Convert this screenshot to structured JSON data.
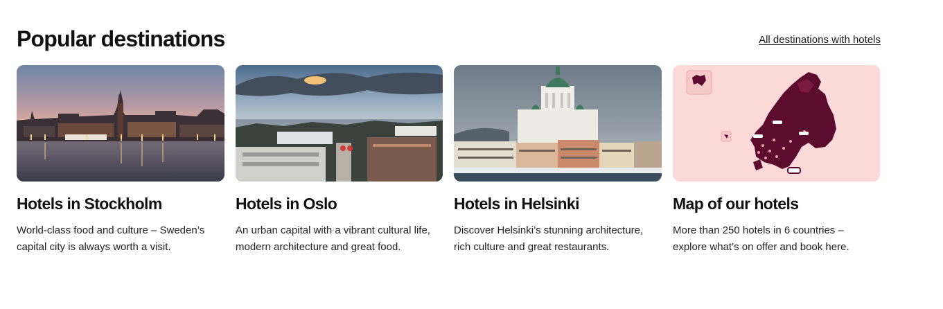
{
  "section": {
    "title": "Popular destinations",
    "all_link": "All destinations with hotels"
  },
  "cards": [
    {
      "title": "Hotels in Stockholm",
      "text": "World-class food and culture – Sweden’s capital city is always worth a visit.",
      "image": "stockholm-waterfront-photo"
    },
    {
      "title": "Hotels in Oslo",
      "text": "An urban capital with a vibrant cultural life, modern architecture and great food.",
      "image": "oslo-city-photo"
    },
    {
      "title": "Hotels in Helsinki",
      "text": "Discover Helsinki’s stunning architecture, rich culture and great restaurants.",
      "image": "helsinki-cathedral-photo"
    },
    {
      "title": "Map of our hotels",
      "text": "More than 250 hotels in 6 countries – explore what’s on offer and book here.",
      "image": "nordic-hotel-map-illustration"
    }
  ],
  "colors": {
    "map_background": "#fcd9d9",
    "map_land": "#5c0a2e",
    "text": "#1a1a1a"
  }
}
